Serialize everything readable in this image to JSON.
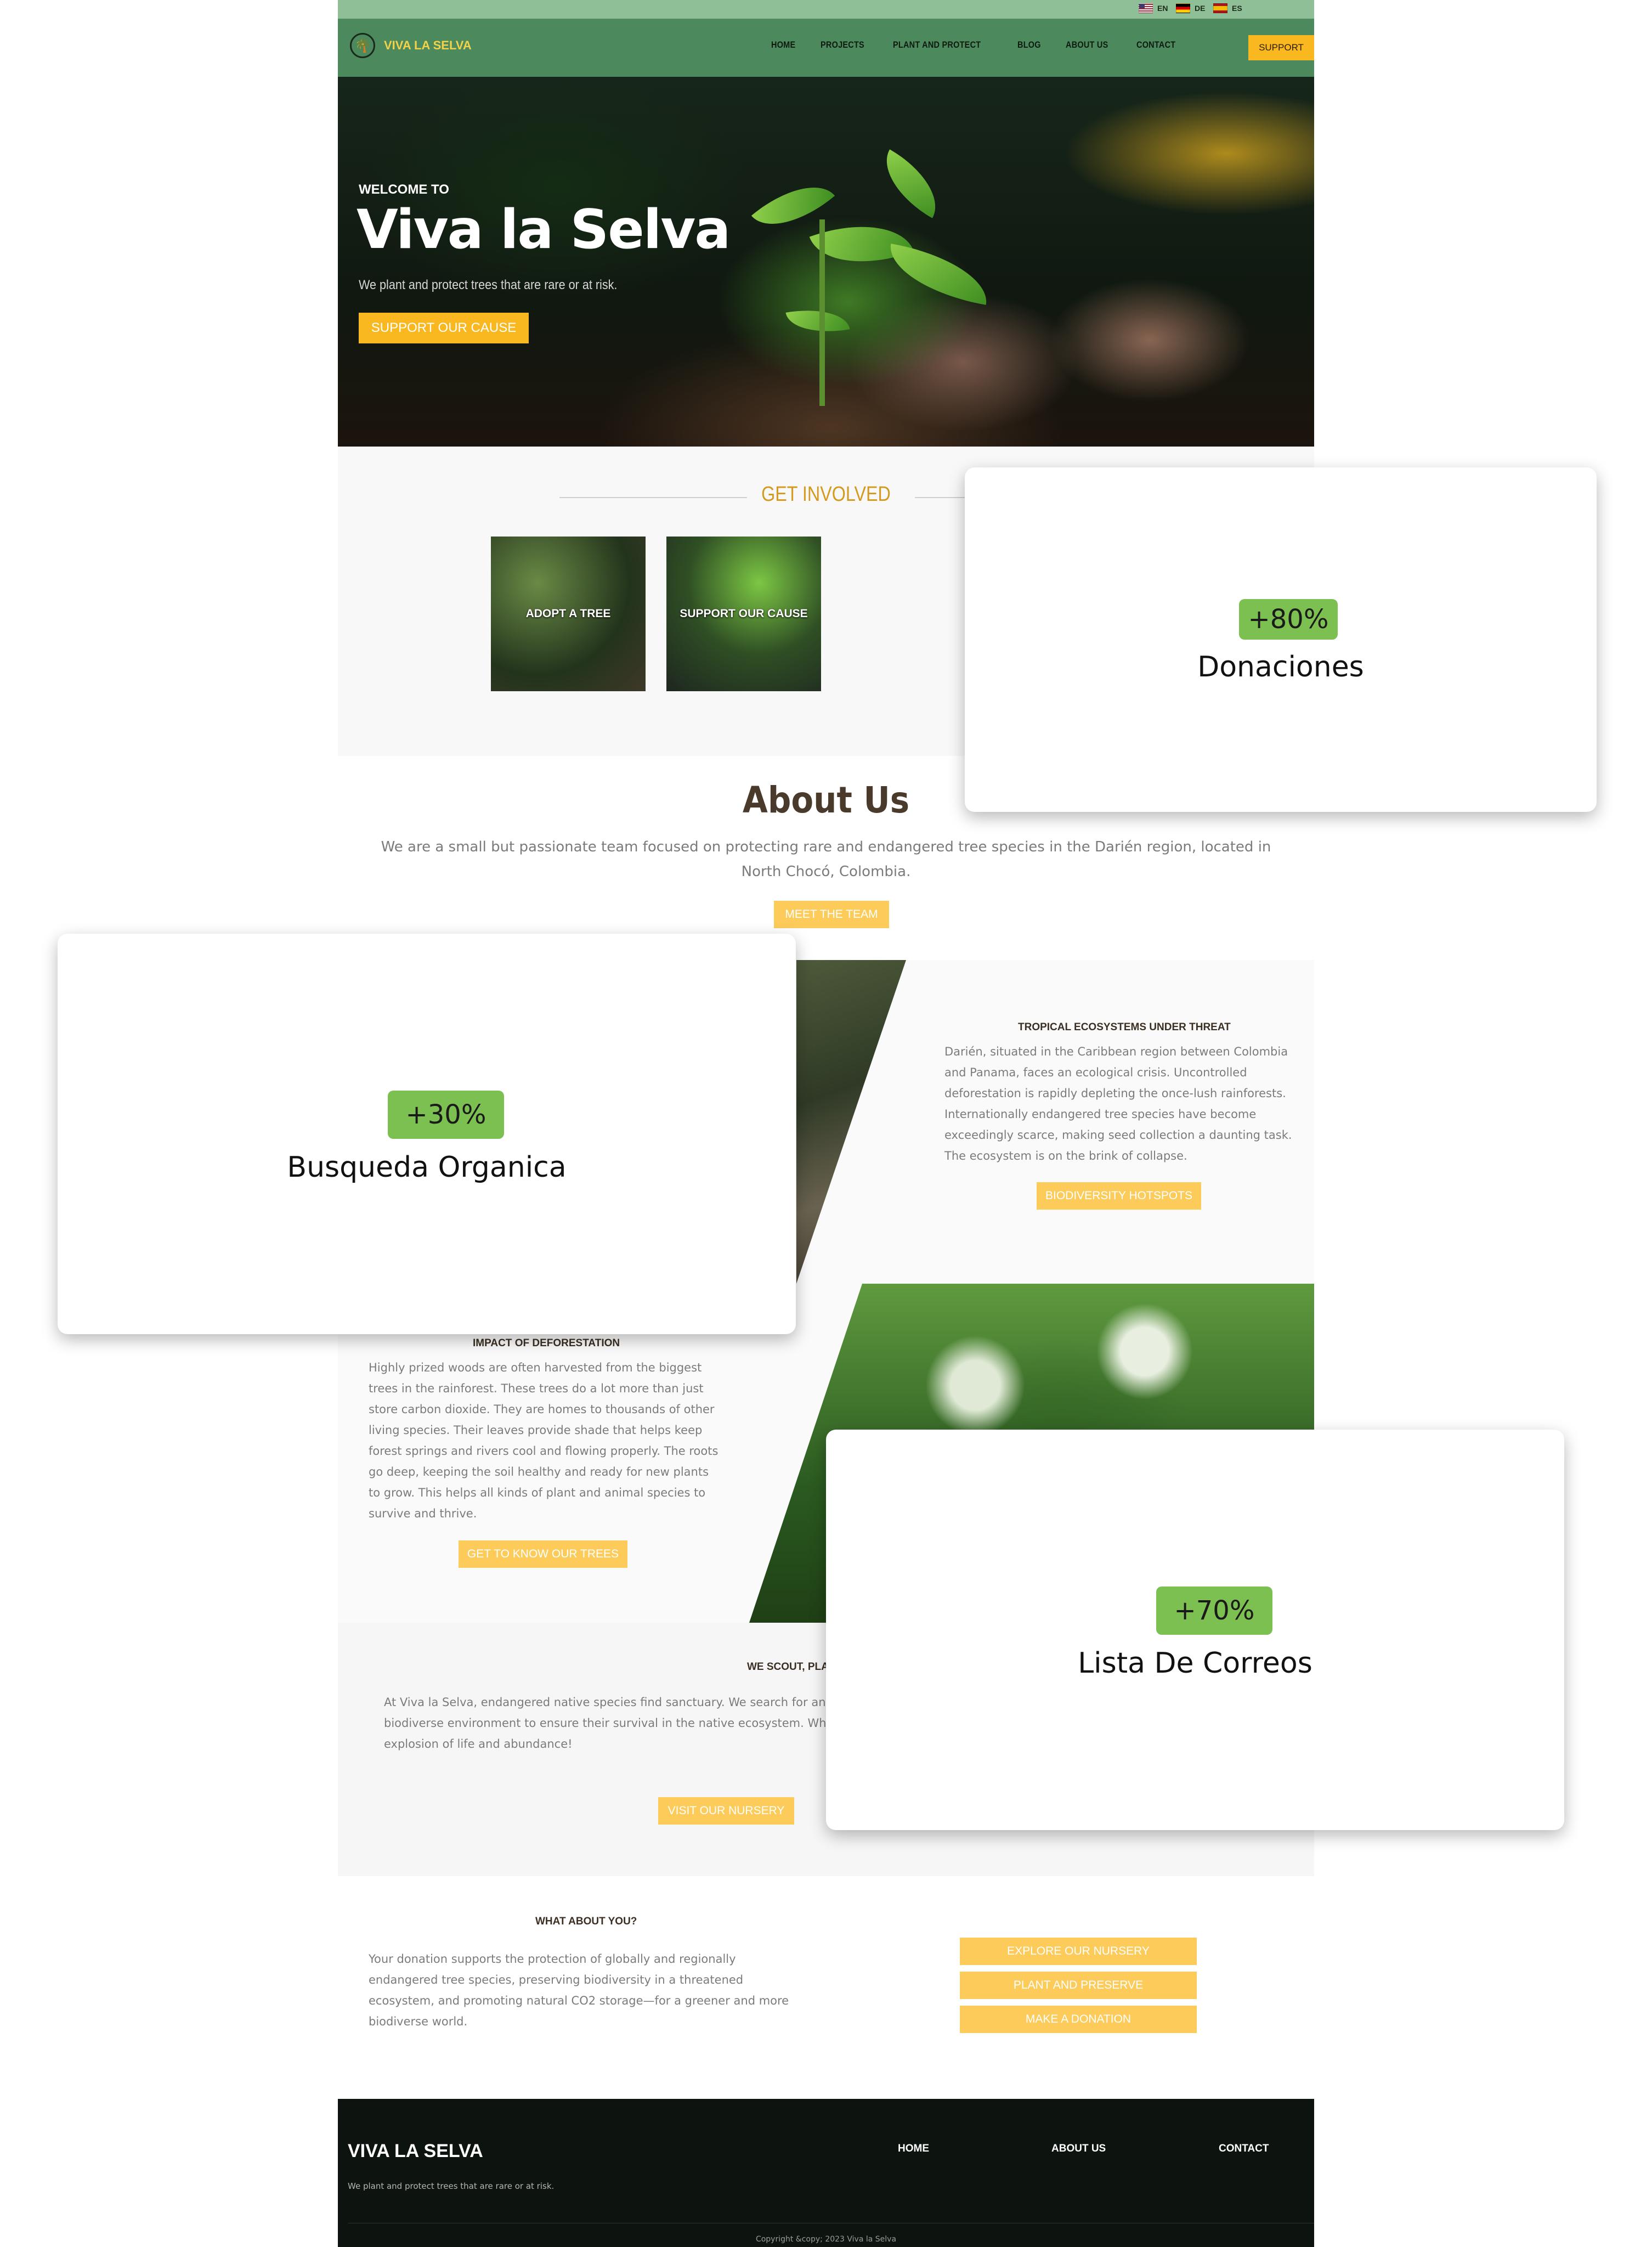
{
  "languages": [
    {
      "code": "EN",
      "flag": "us-flag-icon"
    },
    {
      "code": "DE",
      "flag": "de-flag-icon"
    },
    {
      "code": "ES",
      "flag": "es-flag-icon"
    }
  ],
  "nav": {
    "logo_text": "VIVA LA SELVA",
    "logo_icon": "palm-tree-icon",
    "items": [
      "HOME",
      "PROJECTS",
      "PLANT AND PROTECT",
      "BLOG",
      "ABOUT US",
      "CONTACT"
    ],
    "support": "SUPPORT"
  },
  "hero": {
    "kicker": "WELCOME TO",
    "title": "Viva la Selva",
    "subtitle": "We plant and protect trees that are rare or at risk.",
    "button": "SUPPORT OUR CAUSE"
  },
  "involved": {
    "title": "GET INVOLVED",
    "cards": [
      "ADOPT A TREE",
      "SUPPORT OUR CAUSE"
    ]
  },
  "about": {
    "title": "About Us",
    "text": "We are a small but passionate team focused on protecting rare and endangered tree species in the Darién region, located in North Chocó, Colombia.",
    "button": "MEET THE TEAM"
  },
  "threat": {
    "heading": "TROPICAL ECOSYSTEMS UNDER THREAT",
    "body": "Darién, situated in the Caribbean region between Colombia and Panama, faces an ecological crisis. Uncontrolled deforestation is rapidly depleting the once-lush rainforests. Internationally endangered tree species have become exceedingly scarce, making seed collection a daunting task. The ecosystem is on the brink of collapse.",
    "button": "BIODIVERSITY HOTSPOTS"
  },
  "deforestation": {
    "heading": "IMPACT OF DEFORESTATION",
    "body": "Highly prized woods are often harvested from the biggest trees in the rainforest. These trees do a lot more than just store carbon dioxide. They are homes to thousands of other living species. Their leaves provide shade that helps keep forest springs and rivers cool and flowing properly. The roots go deep, keeping the soil healthy and ready for new plants to grow. This helps all kinds of plant and animal species to survive and thrive.",
    "button": "GET TO KNOW OUR TREES"
  },
  "scout": {
    "heading": "WE SCOUT, PLA",
    "body": "At Viva la Selva, endangered native species find sanctuary. We search for and biodiverse environment to ensure their survival in the native ecosystem. Whil explosion of life and abundance!",
    "button": "VISIT OUR NURSERY"
  },
  "whatabout": {
    "heading": "WHAT ABOUT YOU?",
    "body": "Your donation supports the protection of globally and regionally endangered tree species, preserving biodiversity in a threatened ecosystem, and promoting natural CO2 storage—for a greener and more biodiverse world.",
    "buttons": [
      "EXPLORE OUR NURSERY",
      "PLANT AND PRESERVE",
      "MAKE A DONATION"
    ]
  },
  "footer": {
    "brand": "VIVA LA SELVA",
    "tagline": "We plant and protect trees that are rare or at risk.",
    "links": [
      "HOME",
      "ABOUT US",
      "CONTACT"
    ],
    "copyright": "Copyright &copy; 2023 Viva la Selva"
  },
  "stats": [
    {
      "value": "+80%",
      "label": "Donaciones"
    },
    {
      "value": "+30%",
      "label": "Busqueda Organica"
    },
    {
      "value": "+70%",
      "label": "Lista De Correos"
    }
  ],
  "colors": {
    "nav_green": "#4c8a5e",
    "lang_bar": "#8fbf96",
    "accent_yellow": "#f9b81f",
    "light_yellow": "#fdcb5a",
    "stat_green": "#7dc052",
    "footer_bg": "#0d1410"
  }
}
